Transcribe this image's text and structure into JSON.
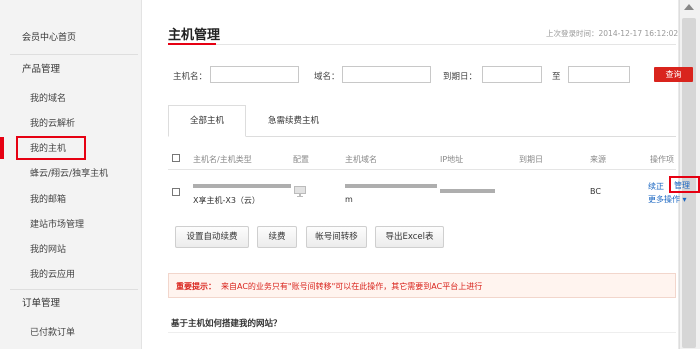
{
  "sidebar": {
    "member_home": "会员中心首页",
    "products_heading": "产品管理",
    "items": [
      {
        "label": "我的域名"
      },
      {
        "label": "我的云解析"
      },
      {
        "label": "我的主机"
      },
      {
        "label": "蜂云/翔云/独享主机"
      },
      {
        "label": "我的邮箱"
      },
      {
        "label": "建站市场管理"
      },
      {
        "label": "我的网站"
      },
      {
        "label": "我的云应用"
      }
    ],
    "orders_heading": "订单管理",
    "order_items": [
      {
        "label": "已付款订单"
      }
    ]
  },
  "page": {
    "title": "主机管理",
    "last_login_label": "上次登录时间：",
    "last_login_value": "2014-12-17 16:12:02"
  },
  "filters": {
    "host_name_label": "主机名：",
    "domain_label": "域名：",
    "expiry_label": "到期日：",
    "to_label": "至",
    "query_button": "查询"
  },
  "tabs": [
    {
      "label": "全部主机",
      "active": true
    },
    {
      "label": "急需续费主机",
      "active": false
    }
  ],
  "table": {
    "headers": {
      "name_type": "主机名/主机类型",
      "config": "配置",
      "domain": "主机域名",
      "ip": "IP地址",
      "expiry": "到期日",
      "source": "来源",
      "actions": "操作项"
    },
    "rows": [
      {
        "host_type": "X享主机-X3（云）",
        "domain_suffix": "m",
        "source": "BC",
        "action_renew": "续正",
        "action_manage": "管理",
        "action_more": "更多操作 ▾"
      }
    ]
  },
  "buttons": {
    "auto_renew": "设置自动续费",
    "renew": "续费",
    "transfer": "帐号间转移",
    "export": "导出Excel表"
  },
  "notice": {
    "label": "重要提示：",
    "text": "来自AC的业务只有\"账号间转移\"可以在此操作，其它需要到AC平台上进行"
  },
  "faq": {
    "title": "基于主机如何搭建我的网站？"
  },
  "colors": {
    "accent": "#e60012",
    "query_button": "#d9241d",
    "link": "#1a66c2"
  }
}
